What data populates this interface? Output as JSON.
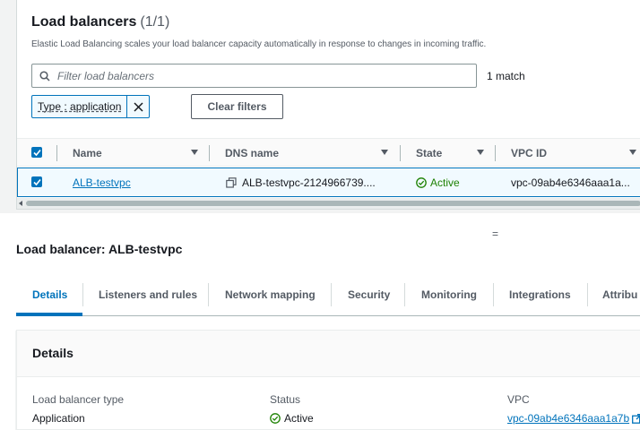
{
  "list": {
    "title": "Load balancers",
    "count": "(1/1)",
    "description": "Elastic Load Balancing scales your load balancer capacity automatically in response to changes in incoming traffic.",
    "filter": {
      "placeholder": "Filter load balancers",
      "value": ""
    },
    "match_count": "1 match",
    "token_label": "Type : application",
    "clear_filters_label": "Clear filters",
    "columns": [
      "Name",
      "DNS name",
      "State",
      "VPC ID"
    ],
    "rows": [
      {
        "name": "ALB-testvpc",
        "dns": "ALB-testvpc-2124966739....",
        "state": "Active",
        "vpc": "vpc-09ab4e6346aaa1a..."
      }
    ]
  },
  "detail": {
    "title": "Load balancer: ALB-testvpc",
    "tabs": [
      "Details",
      "Listeners and rules",
      "Network mapping",
      "Security",
      "Monitoring",
      "Integrations",
      "Attribu"
    ],
    "active_tab": "Details",
    "section_title": "Details",
    "fields": {
      "lb_type_label": "Load balancer type",
      "lb_type_value": "Application",
      "status_label": "Status",
      "status_value": "Active",
      "vpc_label": "VPC",
      "vpc_value": "vpc-09ab4e6346aaa1a7b"
    }
  },
  "divider_glyph": "=",
  "colors": {
    "accent": "#0073bb",
    "active_green": "#1d8102",
    "text": "#16191f",
    "muted": "#545b64"
  },
  "icons": [
    "search-icon",
    "close-icon",
    "checkbox-checked-icon",
    "sort-caret-icon",
    "copy-icon",
    "status-check-icon",
    "external-link-icon"
  ]
}
